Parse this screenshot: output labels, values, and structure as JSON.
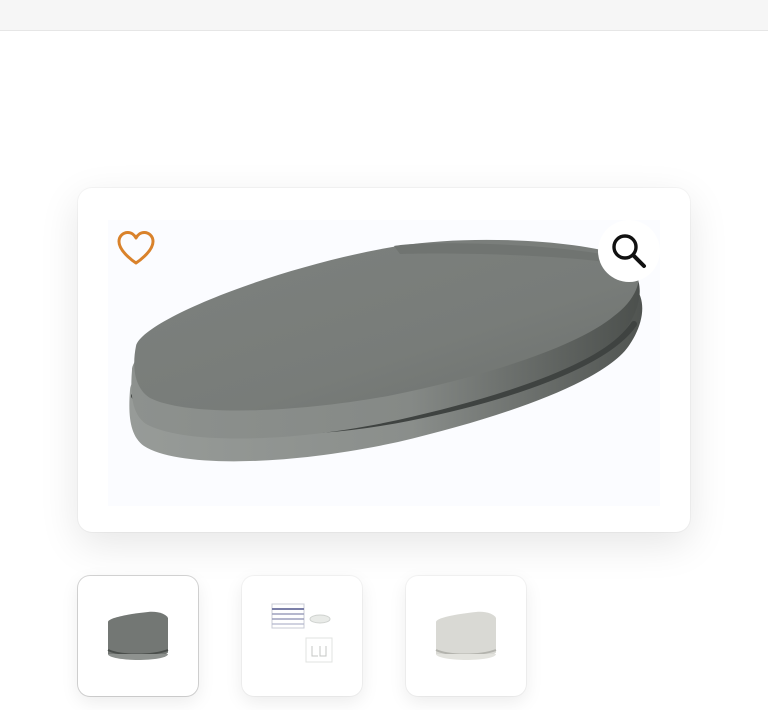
{
  "gallery": {
    "main_image": {
      "icon": "toilet-seat-grey-image",
      "seat_color": "#7a7e7b"
    },
    "wishlist": {
      "icon": "heart-outline-icon",
      "color": "#d9822b"
    },
    "zoom": {
      "icon": "magnifier-icon"
    },
    "thumbnails": [
      {
        "icon": "toilet-seat-grey-thumbnail",
        "selected": true
      },
      {
        "icon": "dimensions-diagram-thumbnail",
        "selected": false
      },
      {
        "icon": "toilet-seat-light-grey-thumbnail",
        "selected": false
      }
    ]
  },
  "colors": {
    "card_background": "#ffffff",
    "image_background": "#fbfcff",
    "top_bar": "#f6f6f6"
  }
}
